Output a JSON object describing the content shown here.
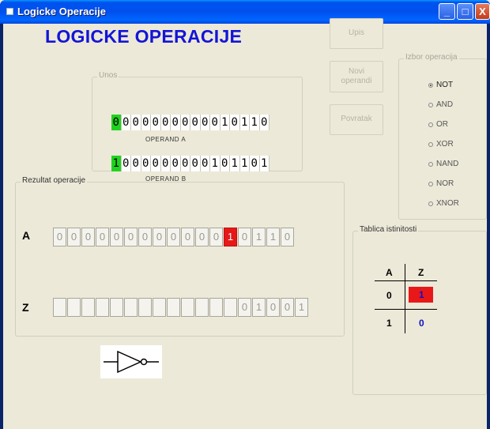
{
  "window": {
    "title": "Logicke Operacije",
    "min_label": "_",
    "max_label": "□",
    "close_label": "X"
  },
  "header": {
    "title": "LOGICKE OPERACIJE"
  },
  "buttons": {
    "upis": "Upis",
    "novi_line1": "Novi",
    "novi_line2": "operandi",
    "povratak": "Povratak"
  },
  "unos": {
    "legend": "Unos",
    "operand_a": {
      "bits": [
        "0",
        "0",
        "0",
        "0",
        "0",
        "0",
        "0",
        "0",
        "0",
        "0",
        "0",
        "1",
        "0",
        "1",
        "1",
        "0"
      ],
      "label": "OPERAND  A"
    },
    "operand_b": {
      "bits": [
        "1",
        "0",
        "0",
        "0",
        "0",
        "0",
        "0",
        "0",
        "0",
        "0",
        "1",
        "0",
        "1",
        "1",
        "0",
        "1"
      ],
      "label": "OPERAND  B"
    }
  },
  "izbor": {
    "legend": "Izbor operacija",
    "options": [
      "NOT",
      "AND",
      "OR",
      "XOR",
      "NAND",
      "NOR",
      "XNOR"
    ],
    "selected": "NOT"
  },
  "rezultat": {
    "legend": "Rezultat operacije",
    "row_a_label": "A",
    "row_a": [
      "0",
      "0",
      "0",
      "0",
      "0",
      "0",
      "0",
      "0",
      "0",
      "0",
      "0",
      "0",
      "1",
      "0",
      "1",
      "1",
      "0"
    ],
    "row_z_label": "Z",
    "row_z": [
      "",
      "",
      "",
      "",
      "",
      "",
      "",
      "",
      "",
      "",
      "",
      "",
      "",
      "0",
      "1",
      "0",
      "0",
      "1"
    ]
  },
  "tablica": {
    "legend": "Tablica istinitosti",
    "header_a": "A",
    "header_z": "Z",
    "row1_a": "0",
    "row1_z": "1",
    "row2_a": "1",
    "row2_z": "0"
  },
  "colors": {
    "accent": "#1414d8",
    "highlight_red": "#e61919",
    "highlight_green": "#1fd21f"
  }
}
